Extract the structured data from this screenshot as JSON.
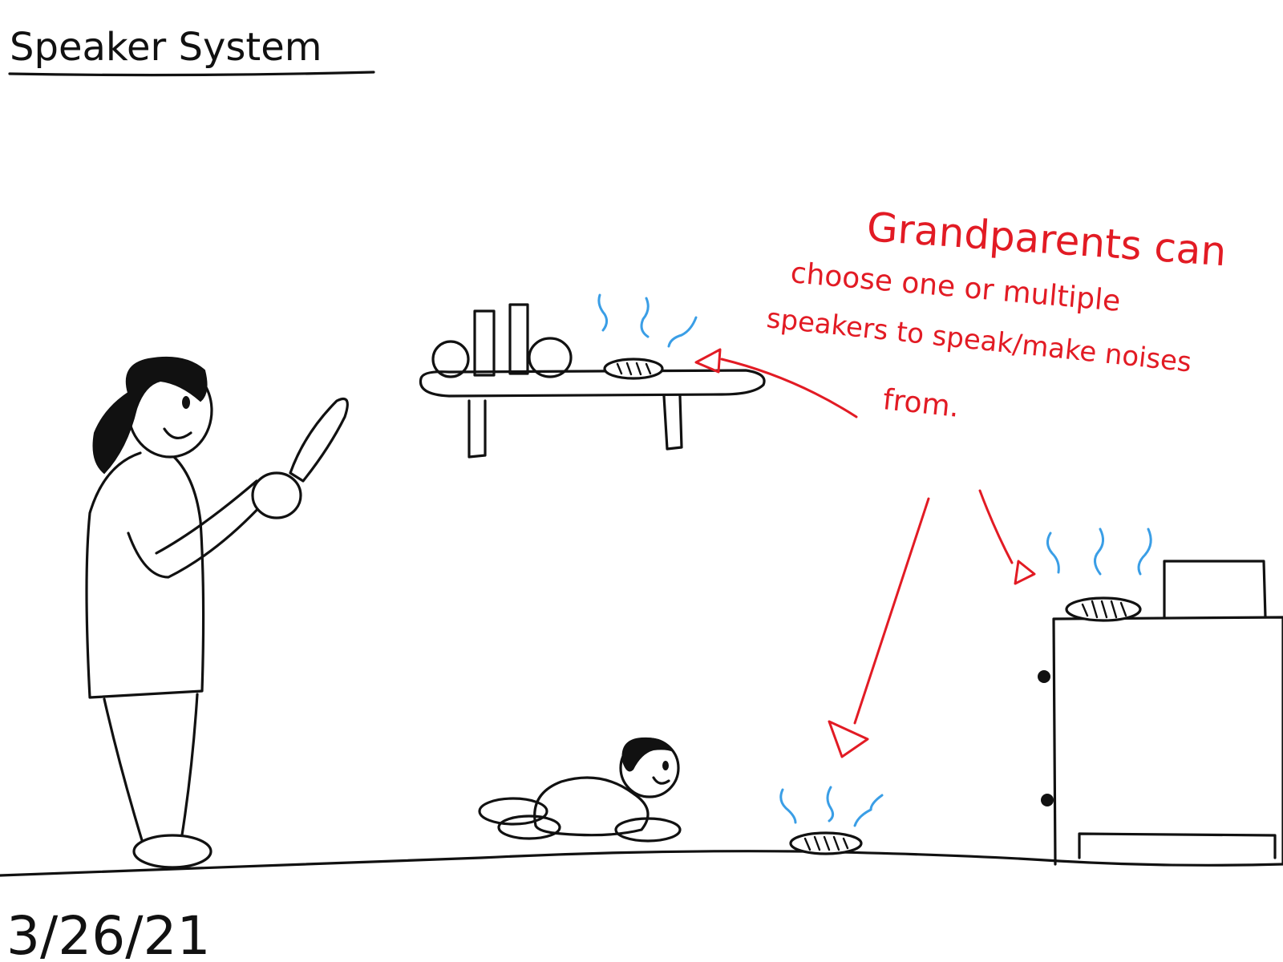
{
  "title": "Speaker System",
  "date": "3/26/21",
  "annotation": {
    "line1": "Grandparents can",
    "line2": "choose one or multiple",
    "line3": "speakers to speak/make noises",
    "line4": "from."
  },
  "colors": {
    "ink": "#111111",
    "annotation": "#e21b24",
    "sound_waves": "#3a9ee6",
    "background": "#ffffff"
  }
}
